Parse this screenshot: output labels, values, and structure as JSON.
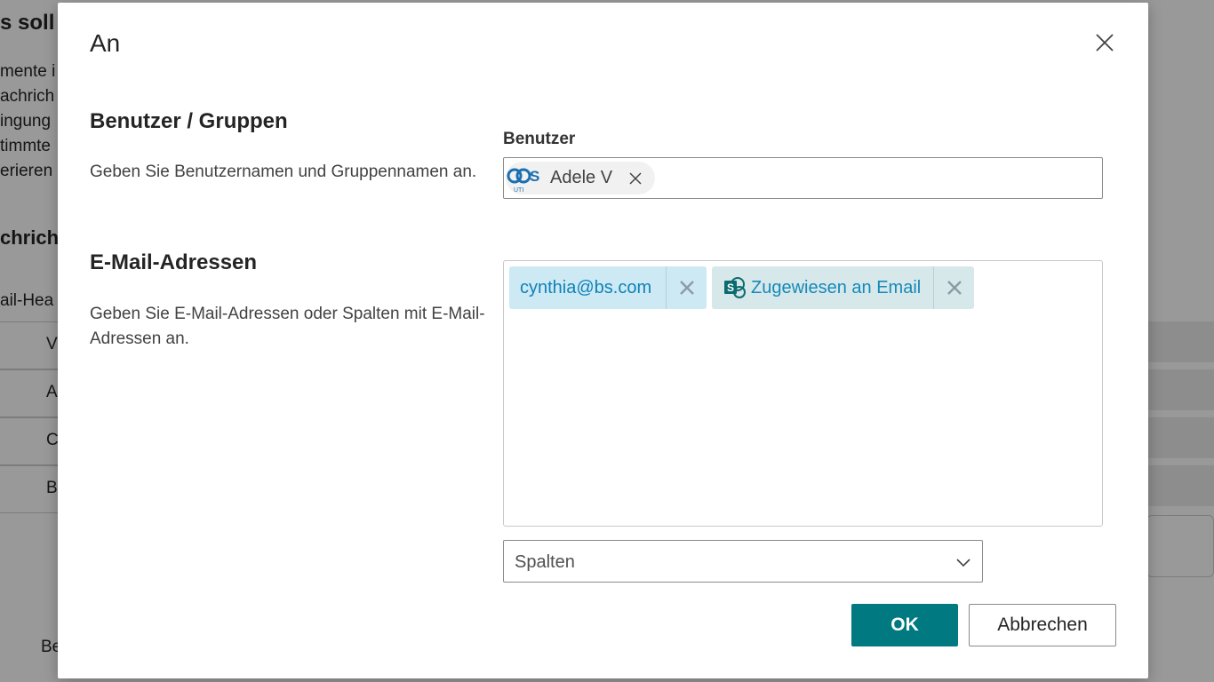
{
  "background": {
    "title": "s soll",
    "lines": [
      "mente i",
      "achrich",
      "ingung",
      "timmte",
      "erieren"
    ],
    "heading": "chrich",
    "subheading": "ail-Hea",
    "rows": [
      "V",
      "A",
      "C",
      "B"
    ],
    "bottom_text": "Be"
  },
  "dialog": {
    "title": "An",
    "close_icon": "close-icon",
    "users_section": {
      "title": "Benutzer / Gruppen",
      "description": "Geben Sie Benutzernamen und Gruppennamen an.",
      "field_label": "Benutzer",
      "selected_users": [
        {
          "name": "Adele V",
          "avatar_icon": "user-avatar-icon"
        }
      ]
    },
    "email_section": {
      "title": "E-Mail-Adressen",
      "description": "Geben Sie E-Mail-Adressen oder Spalten mit E-Mail-Adressen an.",
      "tags": [
        {
          "label": "cynthia@bs.com",
          "type": "email"
        },
        {
          "label": "Zugewiesen an Email",
          "type": "column",
          "icon": "sharepoint-icon"
        }
      ]
    },
    "columns_dropdown": {
      "placeholder": "Spalten"
    },
    "buttons": {
      "ok": "OK",
      "cancel": "Abbrechen"
    }
  },
  "colors": {
    "primary": "#007a80",
    "email_tag": "#cde9f4",
    "column_tag": "#d7e8ea",
    "tag_text": "#0f82b8"
  }
}
